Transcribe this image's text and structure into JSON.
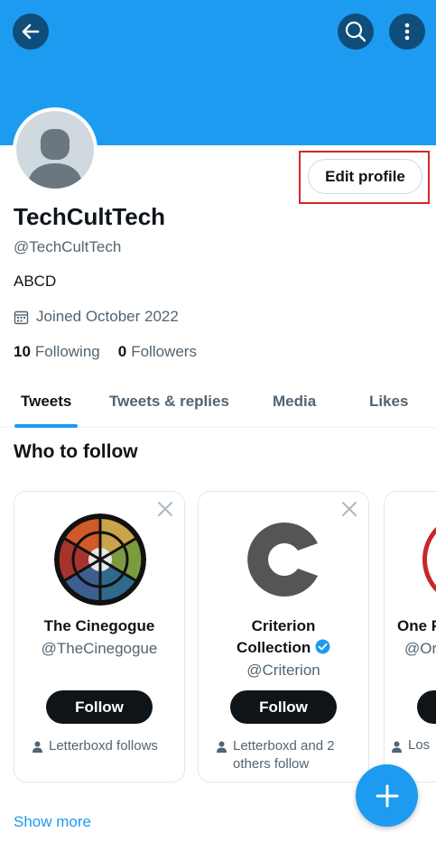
{
  "header": {
    "back_icon": "arrow-left-icon",
    "search_icon": "search-icon",
    "more_icon": "more-vertical-icon",
    "banner_color": "#1d9bf0"
  },
  "profile": {
    "edit_button": "Edit profile",
    "display_name": "TechCultTech",
    "handle": "@TechCultTech",
    "bio": "ABCD",
    "joined": "Joined October 2022",
    "following_count": "10",
    "following_label": "Following",
    "followers_count": "0",
    "followers_label": "Followers"
  },
  "tabs": [
    {
      "label": "Tweets",
      "active": true
    },
    {
      "label": "Tweets & replies",
      "active": false
    },
    {
      "label": "Media",
      "active": false
    },
    {
      "label": "Likes",
      "active": false
    }
  ],
  "who_to_follow": {
    "title": "Who to follow",
    "cards": [
      {
        "name": "The Cinegogue",
        "handle": "@TheCinegogue",
        "follow_label": "Follow",
        "context": "Letterboxd follows"
      },
      {
        "name_line1": "Criterion",
        "name_line2": "Collection",
        "verified": true,
        "handle": "@Criterion",
        "follow_label": "Follow",
        "context_line1": "Letterboxd and 2",
        "context_line2": "others follow"
      },
      {
        "name": "One P",
        "handle": "@Or",
        "context": "Los"
      }
    ],
    "show_more": "Show more"
  },
  "fab": {
    "icon": "plus-icon"
  },
  "colors": {
    "accent": "#1d9bf0",
    "highlight": "#d62828",
    "text": "#0f1419",
    "muted": "#536471"
  }
}
